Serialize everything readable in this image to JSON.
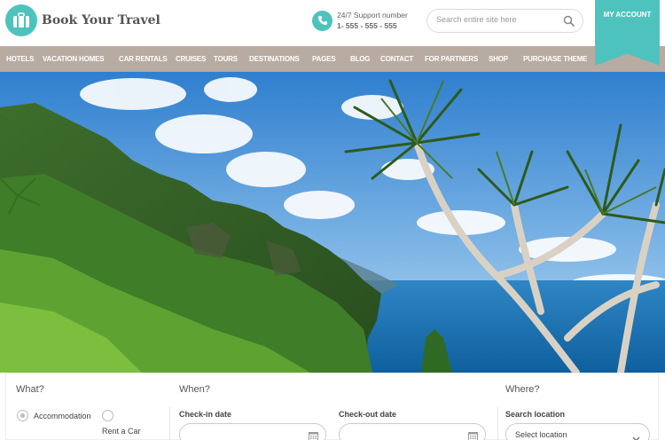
{
  "brand": {
    "name": "Book Your Travel"
  },
  "support": {
    "label": "24/7 Support number",
    "phone": "1- 555 - 555 - 555"
  },
  "search": {
    "placeholder": "Search entire site here"
  },
  "account": {
    "label": "MY ACCOUNT"
  },
  "nav": {
    "items": [
      {
        "label": "HOTELS"
      },
      {
        "label": "VACATION HOMES"
      },
      {
        "label": "CAR RENTALS"
      },
      {
        "label": "CRUISES"
      },
      {
        "label": "TOURS"
      },
      {
        "label": "DESTINATIONS"
      },
      {
        "label": "PAGES"
      },
      {
        "label": "BLOG"
      },
      {
        "label": "CONTACT"
      },
      {
        "label": "FOR PARTNERS"
      },
      {
        "label": "SHOP"
      },
      {
        "label": "PURCHASE THEME"
      }
    ]
  },
  "search_form": {
    "what": {
      "title": "What?",
      "options": [
        {
          "label": "Accommodation",
          "selected": true
        },
        {
          "label": "Rent a Car",
          "selected": false
        }
      ]
    },
    "when": {
      "title": "When?",
      "checkin_label": "Check-in date",
      "checkout_label": "Check-out date",
      "checkin_value": "",
      "checkout_value": ""
    },
    "where": {
      "title": "Where?",
      "location_label": "Search location",
      "location_value": "Select location"
    }
  },
  "colors": {
    "accent": "#4ec3bd",
    "nav_bg": "#b8aba2"
  }
}
